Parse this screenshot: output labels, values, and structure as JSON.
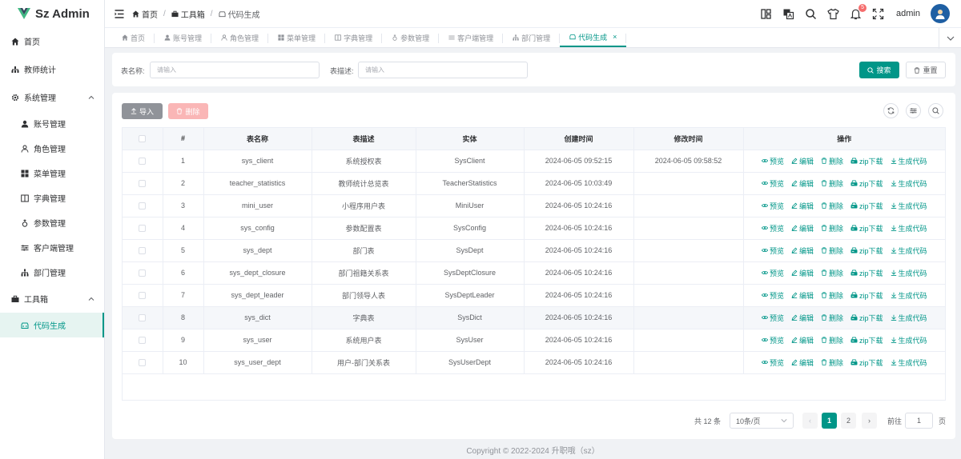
{
  "app": {
    "title": "Sz Admin",
    "brand_color": "#009688"
  },
  "sidebar": {
    "items": [
      {
        "label": "首页",
        "icon": "home-icon"
      },
      {
        "label": "教师统计",
        "icon": "chart-icon"
      },
      {
        "label": "系统管理",
        "icon": "gear-icon"
      },
      {
        "label": "账号管理",
        "icon": "user-icon"
      },
      {
        "label": "角色管理",
        "icon": "user-outline-icon"
      },
      {
        "label": "菜单管理",
        "icon": "grid-icon"
      },
      {
        "label": "字典管理",
        "icon": "book-icon"
      },
      {
        "label": "参数管理",
        "icon": "param-icon"
      },
      {
        "label": "客户端管理",
        "icon": "sliders-icon"
      },
      {
        "label": "部门管理",
        "icon": "org-icon"
      },
      {
        "label": "工具箱",
        "icon": "toolbox-icon"
      },
      {
        "label": "代码生成",
        "icon": "code-gen-icon"
      }
    ]
  },
  "header": {
    "breadcrumb": [
      "首页",
      "工具箱",
      "代码生成"
    ],
    "notification_count": "5",
    "username": "admin"
  },
  "tabs": [
    {
      "label": "首页"
    },
    {
      "label": "账号管理"
    },
    {
      "label": "角色管理"
    },
    {
      "label": "菜单管理"
    },
    {
      "label": "字典管理"
    },
    {
      "label": "参数管理"
    },
    {
      "label": "客户端管理"
    },
    {
      "label": "部门管理"
    },
    {
      "label": "代码生成",
      "close": "×"
    }
  ],
  "search": {
    "table_name_label": "表名称:",
    "table_name_placeholder": "请输入",
    "table_desc_label": "表描述:",
    "table_desc_placeholder": "请输入",
    "search_btn": "搜索",
    "reset_btn": "重置"
  },
  "toolbar": {
    "import_btn": "导入",
    "delete_btn": "删除"
  },
  "table": {
    "headers": [
      "#",
      "表名称",
      "表描述",
      "实体",
      "创建时间",
      "修改时间",
      "操作"
    ],
    "actions": [
      "预览",
      "编辑",
      "删除",
      "zip下载",
      "生成代码"
    ],
    "rows": [
      {
        "no": "1",
        "name": "sys_client",
        "desc": "系统授权表",
        "entity": "SysClient",
        "created": "2024-06-05 09:52:15",
        "updated": "2024-06-05 09:58:52"
      },
      {
        "no": "2",
        "name": "teacher_statistics",
        "desc": "教师统计总览表",
        "entity": "TeacherStatistics",
        "created": "2024-06-05 10:03:49",
        "updated": ""
      },
      {
        "no": "3",
        "name": "mini_user",
        "desc": "小程序用户表",
        "entity": "MiniUser",
        "created": "2024-06-05 10:24:16",
        "updated": ""
      },
      {
        "no": "4",
        "name": "sys_config",
        "desc": "参数配置表",
        "entity": "SysConfig",
        "created": "2024-06-05 10:24:16",
        "updated": ""
      },
      {
        "no": "5",
        "name": "sys_dept",
        "desc": "部门表",
        "entity": "SysDept",
        "created": "2024-06-05 10:24:16",
        "updated": ""
      },
      {
        "no": "6",
        "name": "sys_dept_closure",
        "desc": "部门祖籍关系表",
        "entity": "SysDeptClosure",
        "created": "2024-06-05 10:24:16",
        "updated": ""
      },
      {
        "no": "7",
        "name": "sys_dept_leader",
        "desc": "部门领导人表",
        "entity": "SysDeptLeader",
        "created": "2024-06-05 10:24:16",
        "updated": ""
      },
      {
        "no": "8",
        "name": "sys_dict",
        "desc": "字典表",
        "entity": "SysDict",
        "created": "2024-06-05 10:24:16",
        "updated": ""
      },
      {
        "no": "9",
        "name": "sys_user",
        "desc": "系统用户表",
        "entity": "SysUser",
        "created": "2024-06-05 10:24:16",
        "updated": ""
      },
      {
        "no": "10",
        "name": "sys_user_dept",
        "desc": "用户-部门关系表",
        "entity": "SysUserDept",
        "created": "2024-06-05 10:24:16",
        "updated": ""
      }
    ]
  },
  "pagination": {
    "total": "共 12 条",
    "page_size": "10条/页",
    "prev": "‹",
    "pages": [
      "1",
      "2"
    ],
    "next": "›",
    "goto_label": "前往",
    "goto_value": "1",
    "goto_unit": "页"
  },
  "footer": {
    "copyright": "Copyright © 2022-2024 升职哦（sz）"
  }
}
